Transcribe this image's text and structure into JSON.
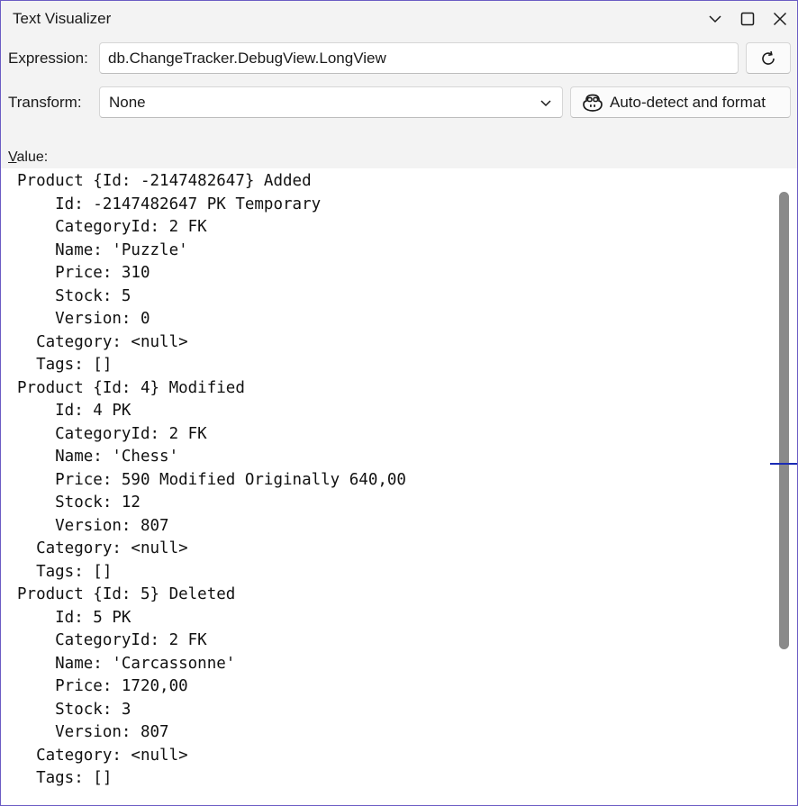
{
  "window": {
    "title": "Text Visualizer"
  },
  "expression": {
    "label": "Expression:",
    "value": "db.ChangeTracker.DebugView.LongView"
  },
  "transform": {
    "label": "Transform:",
    "selected": "None",
    "autodetect_label": "Auto-detect and format"
  },
  "value": {
    "label_prefix": "V",
    "label_rest": "alue:",
    "text": "Product {Id: -2147482647} Added\n    Id: -2147482647 PK Temporary\n    CategoryId: 2 FK\n    Name: 'Puzzle'\n    Price: 310\n    Stock: 5\n    Version: 0\n  Category: <null>\n  Tags: []\nProduct {Id: 4} Modified\n    Id: 4 PK\n    CategoryId: 2 FK\n    Name: 'Chess'\n    Price: 590 Modified Originally 640,00\n    Stock: 12\n    Version: 807\n  Category: <null>\n  Tags: []\nProduct {Id: 5} Deleted\n    Id: 5 PK\n    CategoryId: 2 FK\n    Name: 'Carcassonne'\n    Price: 1720,00\n    Stock: 3\n    Version: 807\n  Category: <null>\n  Tags: []"
  },
  "icons": {
    "collapse": "chevron-down-icon",
    "maximize": "maximize-icon",
    "close": "close-icon",
    "refresh": "refresh-icon",
    "dropdown": "chevron-down-icon",
    "copilot": "copilot-icon"
  },
  "colors": {
    "window_border": "#6b5cc4",
    "scroll_marker": "#1a2bb5"
  }
}
